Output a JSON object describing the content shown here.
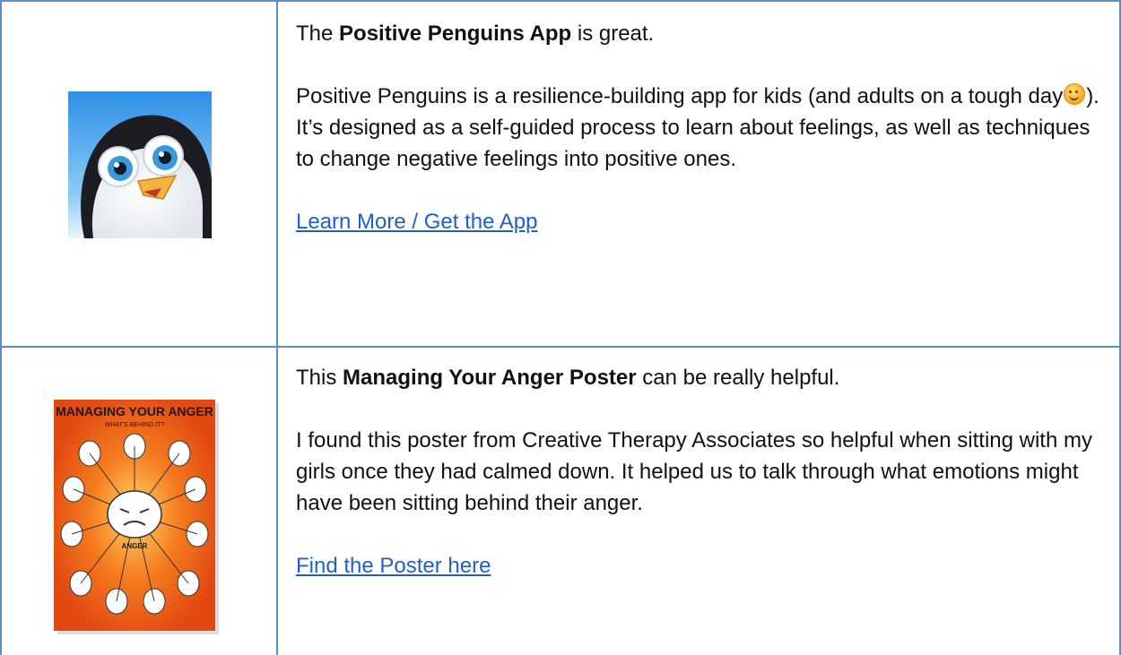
{
  "rows": [
    {
      "intro_pre": "The ",
      "intro_bold": "Positive Penguins App",
      "intro_post": " is great.",
      "body_part1": "Positive Penguins is a resilience-building app for kids (and adults on a tough day",
      "emoji": "smiling-face-emoji",
      "body_part2": "). It’s designed as a self-guided process to learn about feelings, as well as techniques to change negative feelings into positive ones.",
      "link_text": "Learn More / Get the App"
    },
    {
      "intro_pre": "This ",
      "intro_bold": "Managing Your Anger Poster",
      "intro_post": " can be really helpful.",
      "body": "I found this poster from Creative Therapy Associates so helpful when sitting with my girls once they had calmed down. It helped us to talk through what emotions might have been sitting behind their anger.",
      "link_text": "Find the Poster here",
      "poster_title": "MANAGING YOUR ANGER",
      "poster_subtitle": "WHAT'S BEHIND IT?",
      "poster_center_label": "ANGER"
    }
  ],
  "colors": {
    "border": "#5b8fc7",
    "link": "#1f5fd0"
  }
}
